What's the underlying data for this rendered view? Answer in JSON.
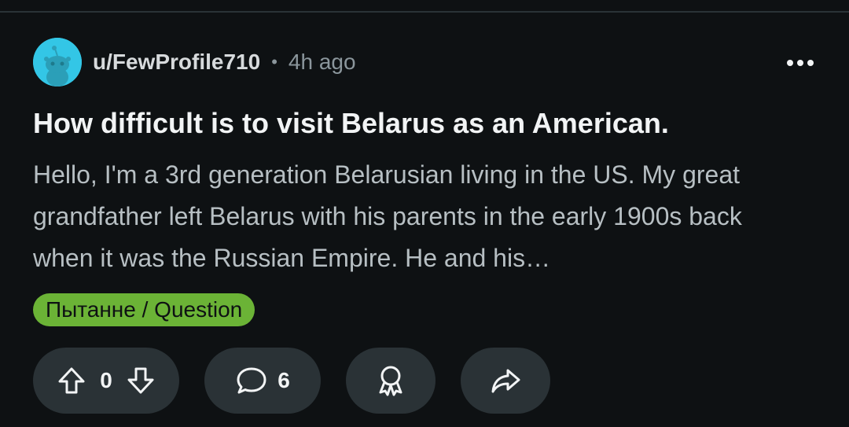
{
  "post": {
    "author": "u/FewProfile710",
    "separator": "•",
    "time_ago": "4h ago",
    "title": "How difficult is to visit Belarus as an American.",
    "body": "Hello, I'm a 3rd generation Belarusian living in the US. My great grandfather left Belarus with his parents in the early 1900s back when it was the Russian Empire. He and his…",
    "flair": "Пытанне / Question",
    "flair_color": "#6bb336",
    "avatar_color": "#33c6e6"
  },
  "actions": {
    "vote_count": "0",
    "comment_count": "6",
    "icons": {
      "upvote": "arrow-up-icon",
      "downvote": "arrow-down-icon",
      "comment": "speech-bubble-icon",
      "award": "award-ribbon-icon",
      "share": "share-arrow-icon",
      "more": "more-horizontal-icon"
    }
  }
}
